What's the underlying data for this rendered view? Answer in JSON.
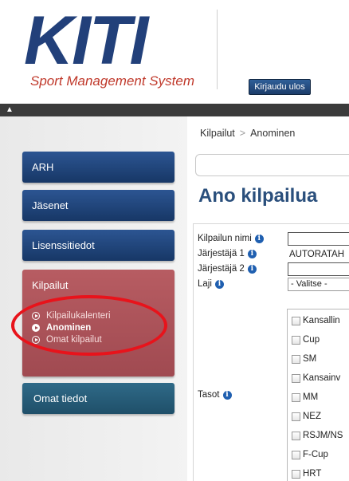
{
  "logo": {
    "wordmark": "KITI",
    "tagline": "Sport Management System"
  },
  "header": {
    "logout_label": "Kirjaudu ulos"
  },
  "topbar": {
    "collapse_glyph": "▲"
  },
  "sidebar": {
    "items": [
      {
        "label": "ARH"
      },
      {
        "label": "Jäsenet"
      },
      {
        "label": "Lisenssitiedot"
      }
    ],
    "kilpailut": {
      "title": "Kilpailut",
      "subitems": [
        {
          "label": "Kilpailukalenteri",
          "active": false
        },
        {
          "label": "Anominen",
          "active": true
        },
        {
          "label": "Omat kilpailut",
          "active": false
        }
      ]
    },
    "omat_tiedot": "Omat tiedot"
  },
  "breadcrumb": {
    "parent": "Kilpailut",
    "separator": ">",
    "current": "Anominen"
  },
  "page": {
    "title": "Ano kilpailua"
  },
  "form": {
    "info_glyph": "i",
    "kilpailun_nimi_label": "Kilpailun nimi",
    "jarjestaja1_label": "Järjestäjä 1",
    "jarjestaja1_value": "AUTORATAH",
    "jarjestaja2_label": "Järjestäjä 2",
    "laji_label": "Laji",
    "laji_selected": "- Valitse -",
    "tasot_label": "Tasot",
    "tasot_options": [
      "Kansallin",
      "Cup",
      "SM",
      "Kansainv",
      "MM",
      "NEZ",
      "RSJM/NS",
      "F-Cup",
      "HRT"
    ]
  },
  "colors": {
    "nav_blue": "#1f437a",
    "nav_active_red": "#a04a51",
    "nav_teal": "#1f4f69",
    "title_blue": "#2a4f7c",
    "annotation_red": "#e8131b"
  }
}
